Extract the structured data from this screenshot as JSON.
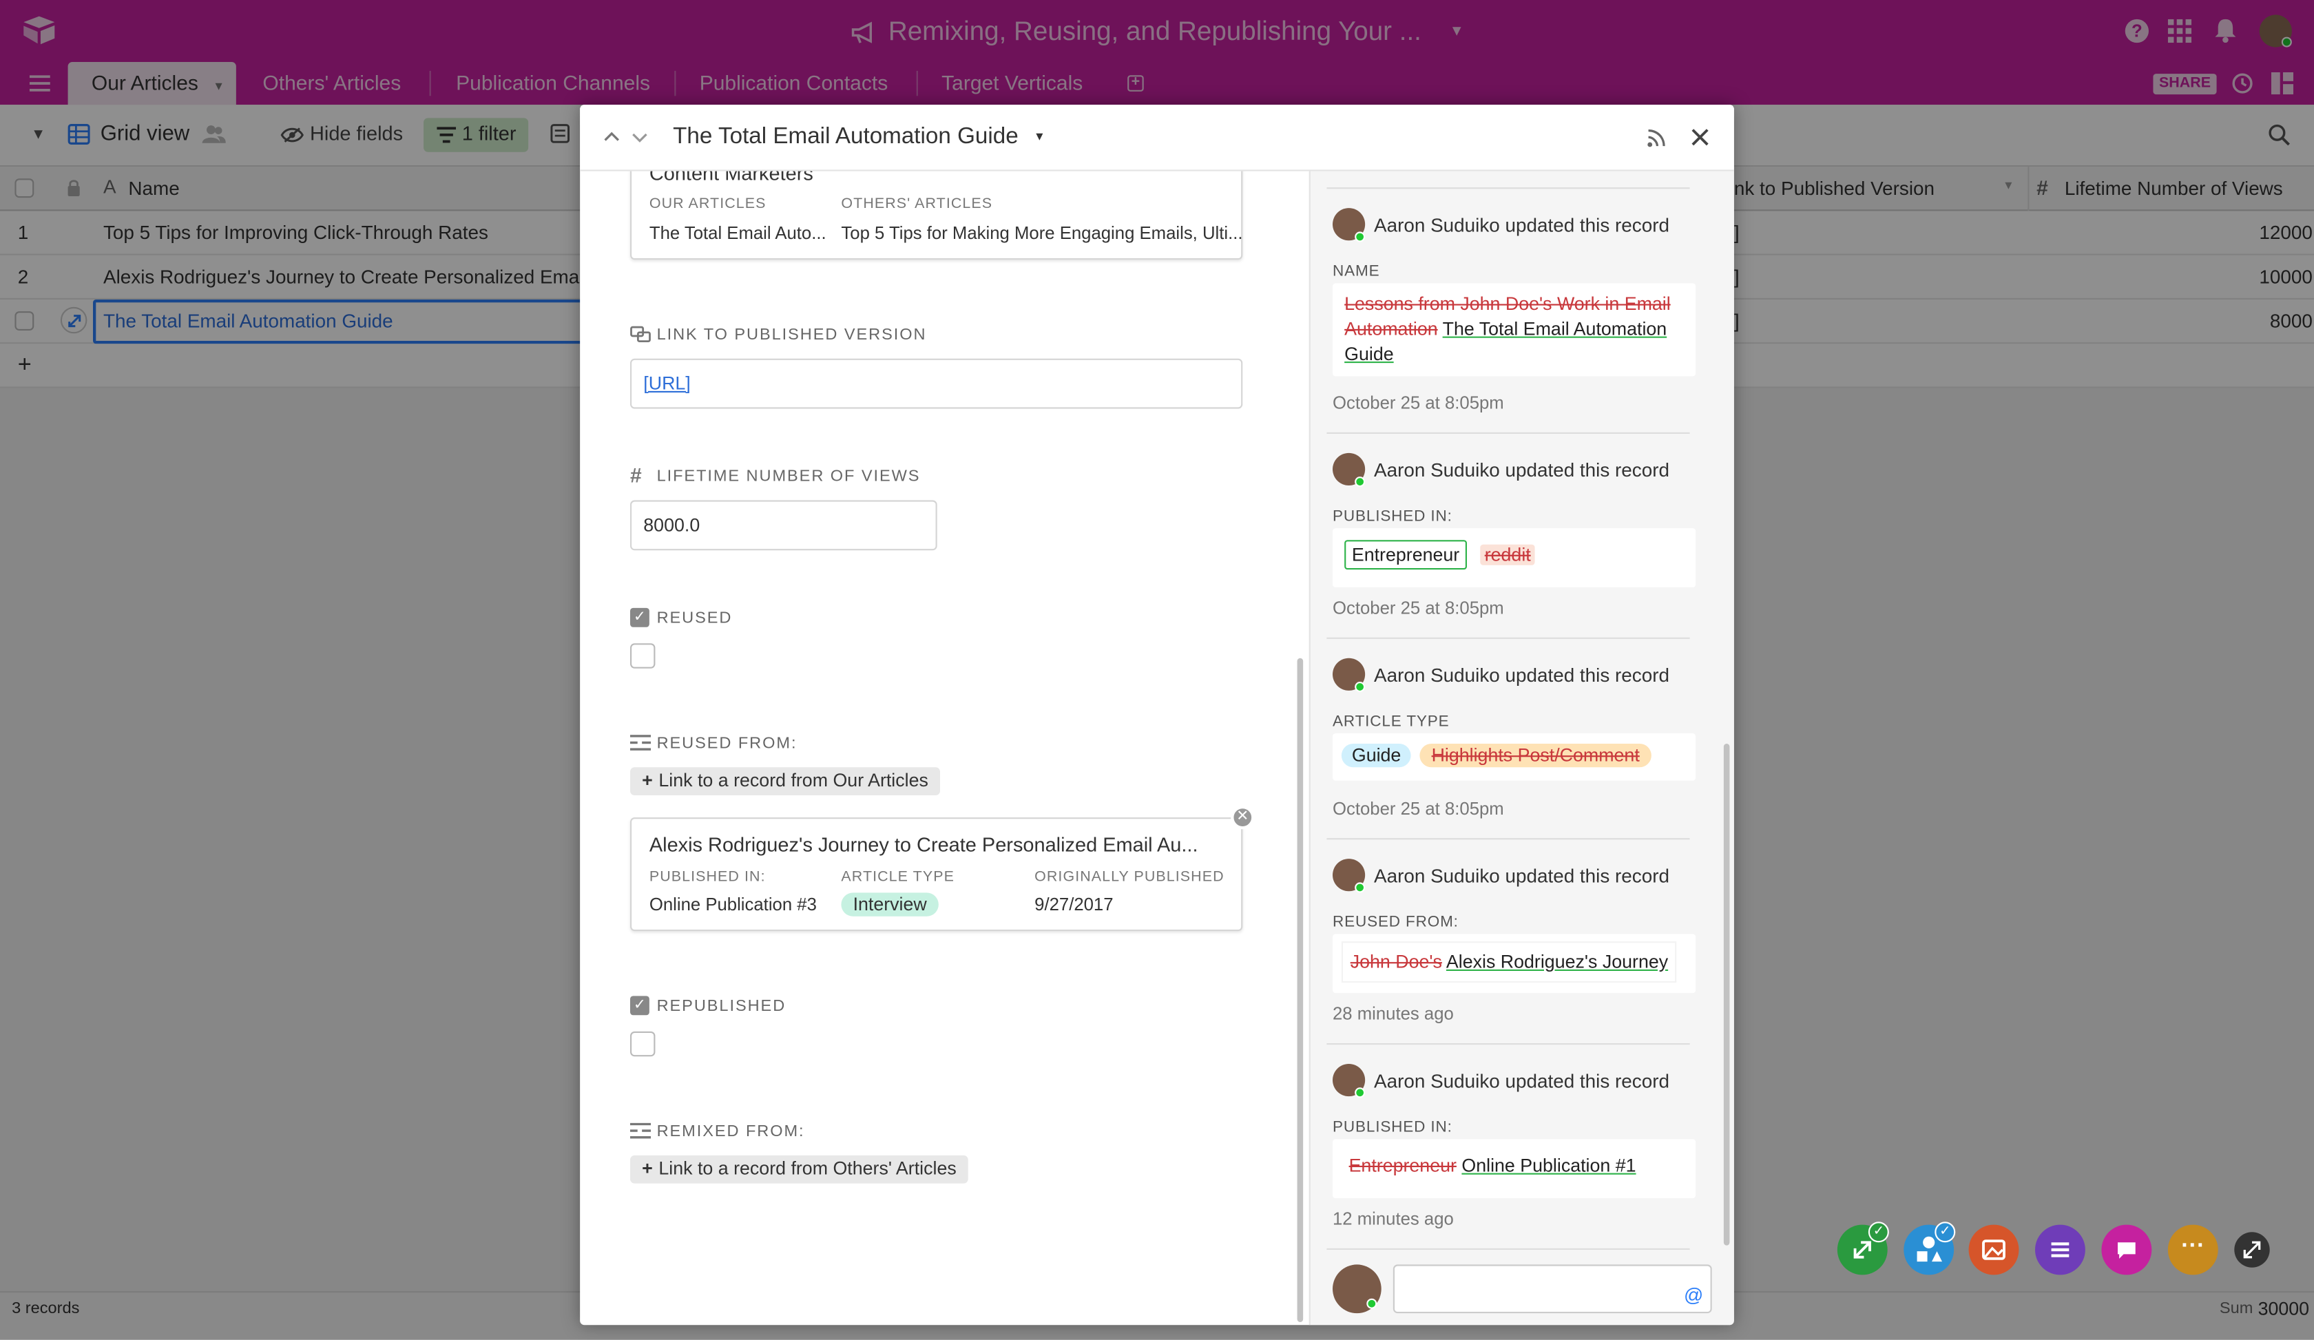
{
  "app": {
    "base_title": "Remixing, Reusing, and Republishing Your ...",
    "colors": {
      "brand": "#c5219f",
      "accent": "#2d7ff9",
      "added": "#2fb34a",
      "removed": "#c8383c"
    }
  },
  "tabs": [
    {
      "label": "Our Articles",
      "active": true
    },
    {
      "label": "Others' Articles",
      "active": false
    },
    {
      "label": "Publication Channels",
      "active": false
    },
    {
      "label": "Publication Contacts",
      "active": false
    },
    {
      "label": "Target Verticals",
      "active": false
    }
  ],
  "topbar": {
    "share_label": "SHARE"
  },
  "toolbar": {
    "view_name": "Grid view",
    "hide_fields": "Hide fields",
    "filter": "1 filter"
  },
  "grid": {
    "columns": {
      "name": "Name",
      "link": "nk to Published Version",
      "views": "Lifetime Number of Views"
    },
    "rows": [
      {
        "num": "1",
        "name": "Top 5 Tips for Improving Click-Through Rates",
        "link": "]",
        "views": "12000"
      },
      {
        "num": "2",
        "name": "Alexis Rodriguez's Journey to Create Personalized Email",
        "link": "]",
        "views": "10000"
      },
      {
        "num": "",
        "name": "The Total Email Automation Guide",
        "link": "]",
        "views": "8000"
      }
    ],
    "add_row": "+",
    "footer": {
      "records": "3 records",
      "sum_label": "Sum",
      "sum_value": "30000"
    }
  },
  "modal": {
    "title": "The Total Email Automation Guide",
    "top_card": {
      "title": "Content Marketers",
      "col1_label": "OUR ARTICLES",
      "col1_value": "The Total Email Auto...",
      "col2_label": "OTHERS' ARTICLES",
      "col2_value": "Top 5 Tips for Making More Engaging Emails, Ulti..."
    },
    "link_field": {
      "label": "LINK TO PUBLISHED VERSION",
      "value": "[URL]"
    },
    "views_field": {
      "label": "LIFETIME NUMBER OF VIEWS",
      "value": "8000.0"
    },
    "reused_field": {
      "label": "REUSED"
    },
    "reused_from": {
      "label": "REUSED FROM:",
      "link_btn": "Link to a record from Our Articles",
      "card": {
        "title": "Alexis Rodriguez's Journey to Create Personalized Email Au...",
        "c1_label": "PUBLISHED IN:",
        "c1_value": "Online Publication #3",
        "c2_label": "ARTICLE TYPE",
        "c2_value": "Interview",
        "c3_label": "ORIGINALLY PUBLISHED",
        "c3_value": "9/27/2017"
      }
    },
    "republished_field": {
      "label": "REPUBLISHED"
    },
    "remixed_from": {
      "label": "REMIXED FROM:",
      "link_btn": "Link to a record from Others' Articles"
    }
  },
  "activity": [
    {
      "who": "Aaron Suduiko updated this record",
      "field": "NAME",
      "removed": "Lessons from John Doe's Work in Email Automation",
      "added": "The Total Email Automation Guide",
      "when": "October 25 at 8:05pm"
    },
    {
      "who": "Aaron Suduiko updated this record",
      "field": "PUBLISHED IN:",
      "added": "Entrepreneur",
      "removed": "reddit",
      "when": "October 25 at 8:05pm"
    },
    {
      "who": "Aaron Suduiko updated this record",
      "field": "ARTICLE TYPE",
      "added": "Guide",
      "removed": "Highlights Post/Comment",
      "when": "October 25 at 8:05pm"
    },
    {
      "who": "Aaron Suduiko updated this record",
      "field": "REUSED FROM:",
      "removed": "John Doe's",
      "added": "Alexis Rodriguez's Journey",
      "when": "28 minutes ago"
    },
    {
      "who": "Aaron Suduiko updated this record",
      "field": "PUBLISHED IN:",
      "removed": "Entrepreneur",
      "added": "Online Publication #1",
      "when": "12 minutes ago"
    }
  ],
  "comment": {
    "mention_symbol": "@"
  }
}
